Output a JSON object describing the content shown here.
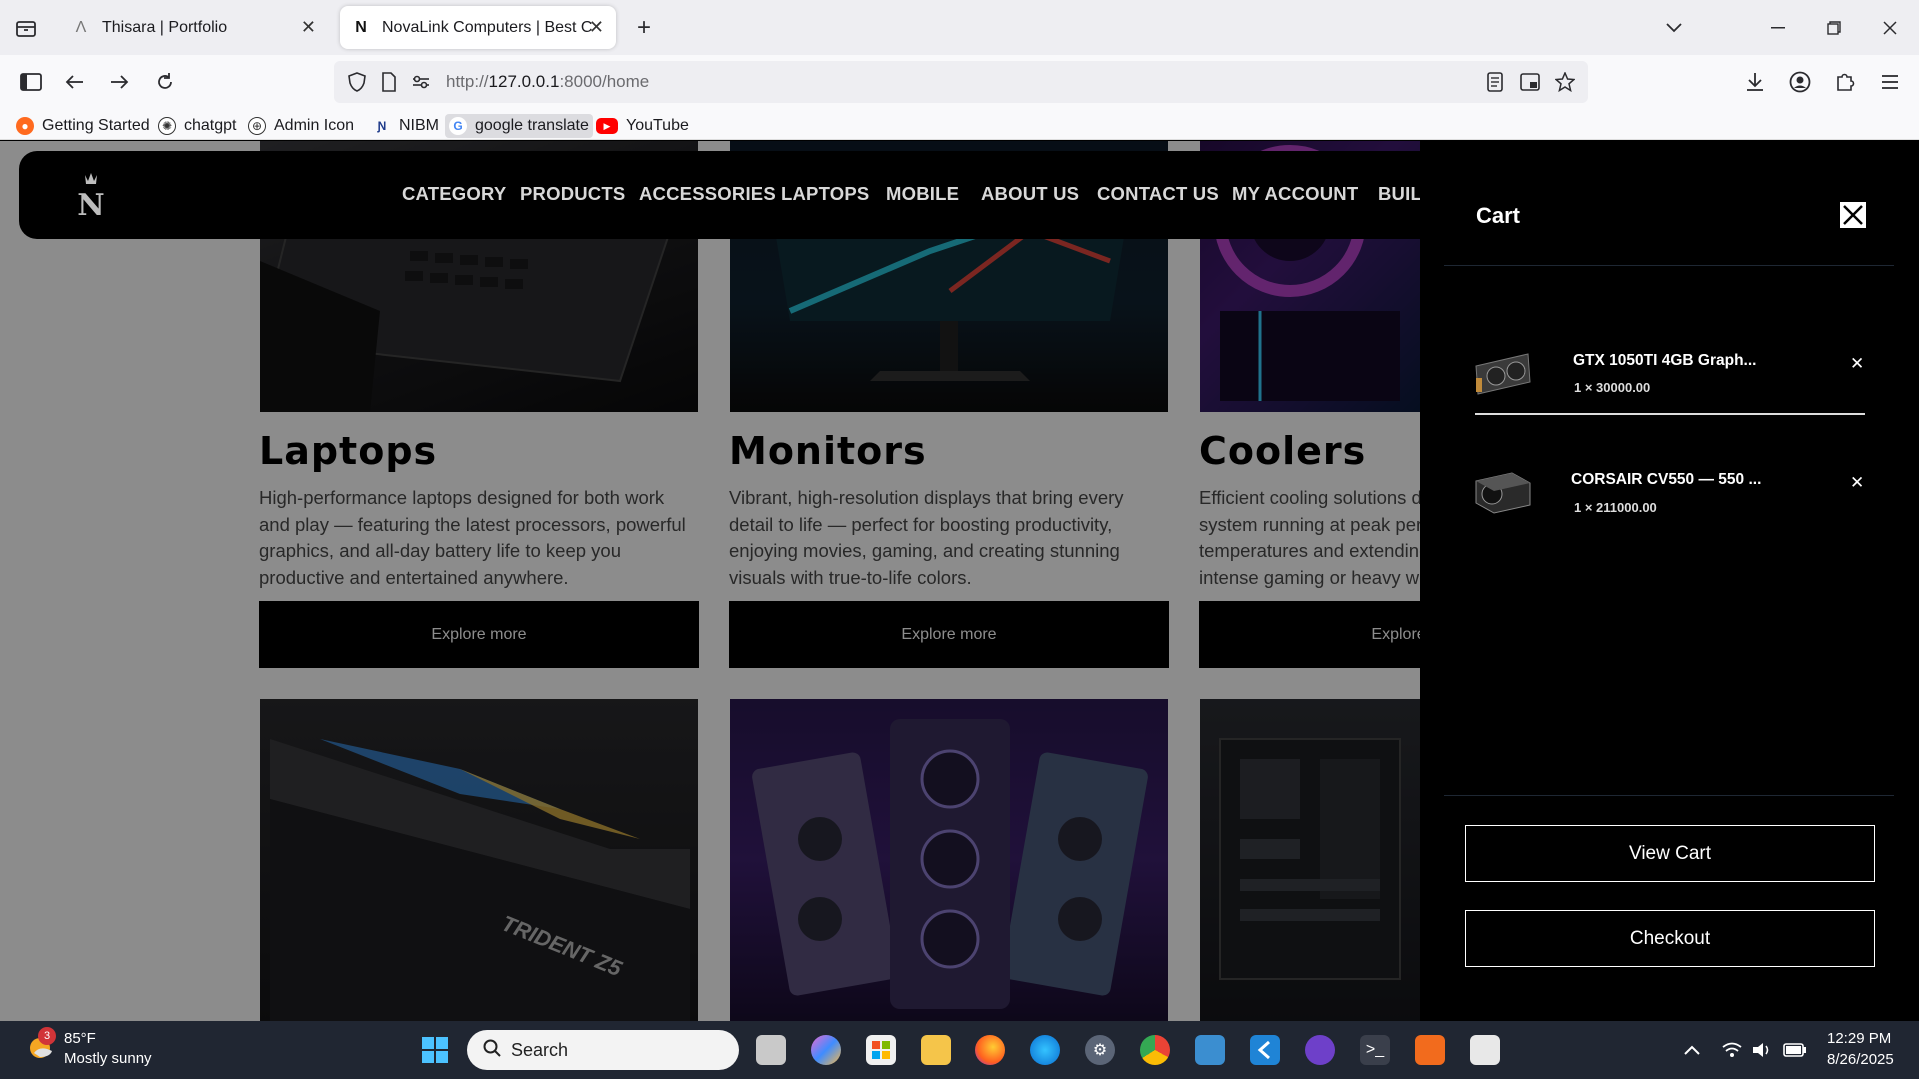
{
  "browser": {
    "tabs": [
      {
        "title": "Thisara | Portfolio",
        "favicon": "portfolio-glyph"
      },
      {
        "title": "NovaLink Computers | Best Com",
        "favicon": "novalink-logo"
      }
    ],
    "url_prefix": "http://",
    "url_host": "127.0.0.1",
    "url_path": ":8000/home",
    "bookmarks": [
      {
        "label": "Getting Started",
        "icon": "firefox-icon"
      },
      {
        "label": "chatgpt",
        "icon": "chatgpt-icon"
      },
      {
        "label": "Admin Icon",
        "icon": "globe-icon"
      },
      {
        "label": "NIBM",
        "icon": "nibm-icon"
      },
      {
        "label": "google translate",
        "icon": "google-icon"
      },
      {
        "label": "YouTube",
        "icon": "youtube-icon"
      }
    ]
  },
  "site": {
    "logo": "N",
    "nav": [
      "CATEGORY",
      "PRODUCTS",
      "ACCESSORIES",
      "LAPTOPS",
      "MOBILE",
      "ABOUT US",
      "CONTACT US",
      "MY ACCOUNT",
      "BUILD"
    ],
    "cards": [
      {
        "title": "Laptops",
        "desc": "High-performance laptops designed for both work and play — featuring the latest processors, powerful graphics, and all-day battery life to keep you productive and entertained anywhere.",
        "button": "Explore more"
      },
      {
        "title": "Monitors",
        "desc": "Vibrant, high-resolution displays that bring every detail to life — perfect for boosting productivity, enjoying movies, gaming, and creating stunning visuals with true-to-life colors.",
        "button": "Explore more"
      },
      {
        "title": "Coolers",
        "desc": "Efficient cooling solutions designed to keep your system running at peak performance, lowering temperatures and extending component life during intense gaming or heavy workloads.",
        "button": "Explore more"
      }
    ],
    "row2_images": [
      "ram-image",
      "gpu-image",
      "motherboard-image"
    ]
  },
  "cart": {
    "title": "Cart",
    "items": [
      {
        "name": "GTX 1050TI 4GB Graph...",
        "qty": "1 × 30000.00",
        "icon": "graphics-card-image"
      },
      {
        "name": "CORSAIR CV550 — 550 ...",
        "qty": "1 × 211000.00",
        "icon": "power-supply-image"
      }
    ],
    "view_cart": "View Cart",
    "checkout": "Checkout"
  },
  "taskbar": {
    "weather_temp": "85°F",
    "weather_desc": "Mostly sunny",
    "weather_badge": "3",
    "search_placeholder": "Search",
    "time": "12:29 PM",
    "date": "8/26/2025"
  }
}
